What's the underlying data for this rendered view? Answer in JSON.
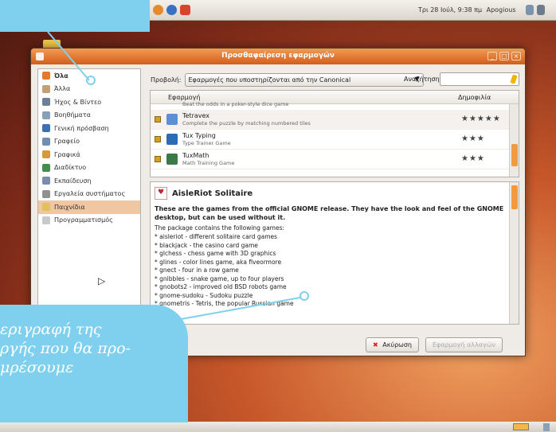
{
  "top_panel": {
    "clock": "Τρι 28 Ιούλ, 9:38 πμ",
    "user": "Apogious"
  },
  "window": {
    "title": "Προσθαφαίρεση εφαρμογών",
    "controls": [
      "_",
      "□",
      "×"
    ]
  },
  "sidebar": {
    "items": [
      {
        "label": "Όλα",
        "icon": "all-icon",
        "color": "#e37a2e"
      },
      {
        "label": "Άλλα",
        "icon": "other-icon",
        "color": "#c2a074"
      },
      {
        "label": "Ήχος & Βίντεο",
        "icon": "audio-video-icon",
        "color": "#6c7f95"
      },
      {
        "label": "Βοηθήματα",
        "icon": "accessories-icon",
        "color": "#8aa0b8"
      },
      {
        "label": "Γενική πρόσβαση",
        "icon": "accessibility-icon",
        "color": "#3b6fb6"
      },
      {
        "label": "Γραφείο",
        "icon": "office-icon",
        "color": "#6f8fb0"
      },
      {
        "label": "Γραφικά",
        "icon": "graphics-icon",
        "color": "#d49a3c"
      },
      {
        "label": "Διαδίκτυο",
        "icon": "internet-icon",
        "color": "#3f8d4f"
      },
      {
        "label": "Εκπαίδευση",
        "icon": "education-icon",
        "color": "#7a8cb0"
      },
      {
        "label": "Εργαλεία συστήματος",
        "icon": "system-tools-icon",
        "color": "#909090"
      },
      {
        "label": "Παιχνίδια",
        "icon": "games-icon",
        "color": "#e1c25a"
      },
      {
        "label": "Προγραμματισμός",
        "icon": "programming-icon",
        "color": "#c8c8c8"
      }
    ]
  },
  "toolbar": {
    "view_label": "Προβολή:",
    "view_value": "Εφαρμογές που υποστηρίζονται από την Canonical",
    "search_label": "Αναζήτηση:",
    "search_value": ""
  },
  "app_list": {
    "col_app": "Εφαρμογή",
    "col_popularity": "Δημοφιλία",
    "partial_desc": "Beat the odds in a poker-style dice game",
    "rows": [
      {
        "name": "Tetravex",
        "desc": "Complete the puzzle by matching numbered tiles",
        "stars": "★★★★★",
        "rating": 5,
        "icon": "tetravex-icon",
        "color": "#5b8fd8"
      },
      {
        "name": "Tux Typing",
        "desc": "Type Trainer Game",
        "stars": "★★★",
        "rating": 3,
        "icon": "tux-typing-icon",
        "color": "#2d6bb3"
      },
      {
        "name": "TuxMath",
        "desc": "Math Training Game",
        "stars": "★★★",
        "rating": 3,
        "icon": "tuxmath-icon",
        "color": "#3a7a48"
      }
    ]
  },
  "description": {
    "title": "AisleRiot Solitaire",
    "intro": "These are the games from the official GNOME release. They have the look and feel of the GNOME desktop, but can be used without it.",
    "package_line": "The package contains the following games:",
    "games": [
      "* aisleriot - different solitaire card games",
      "* blackjack - the casino card game",
      "* glchess - chess game with 3D graphics",
      "* glines - color lines game, aka fiveormore",
      "* gnect - four in a row game",
      "* gnibbles - snake game, up to four players",
      "* gnobots2 - improved old BSD robots game",
      "* gnome-sudoku - Sudoku puzzle",
      "* gnometris - Tetris, the popular Russian game"
    ]
  },
  "buttons": {
    "cancel": "Ακύρωση",
    "apply": "Εφαρμογή αλλαγών"
  },
  "callout": {
    "lines": [
      "εριγραφή της",
      "ργής που θα προ-",
      "μρέσουμε"
    ]
  }
}
